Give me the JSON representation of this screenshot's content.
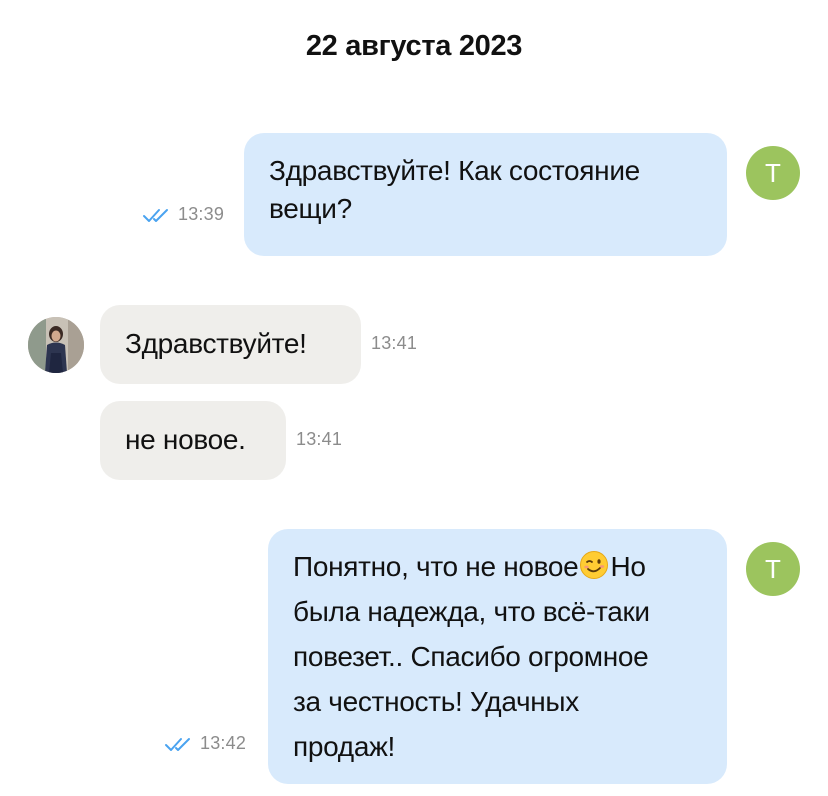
{
  "date_header": "22 августа 2023",
  "messages": [
    {
      "direction": "outgoing",
      "avatar_letter": "Т",
      "text": "Здравствуйте!  Как состояние\nвещи?",
      "time": "13:39",
      "read_status": "read"
    },
    {
      "direction": "incoming",
      "text": "Здравствуйте!",
      "time": "13:41"
    },
    {
      "direction": "incoming",
      "text": "не новое.",
      "time": "13:41"
    },
    {
      "direction": "outgoing",
      "avatar_letter": "Т",
      "text_before_emoji": "Понятно, что не новое",
      "emoji": "wink-emoji",
      "text_after_emoji": "Но\nбыла надежда, что всё-таки\nповезет.. Спасибо огромное\nза честность! Удачных\nпродаж!",
      "time": "13:42",
      "read_status": "read"
    }
  ],
  "colors": {
    "outgoing_bubble": "#d8eafc",
    "incoming_bubble": "#efeeeb",
    "avatar_letter_bg": "#9cc45e",
    "read_ticks": "#4aa3f0",
    "time_text": "#8c8c8c"
  }
}
